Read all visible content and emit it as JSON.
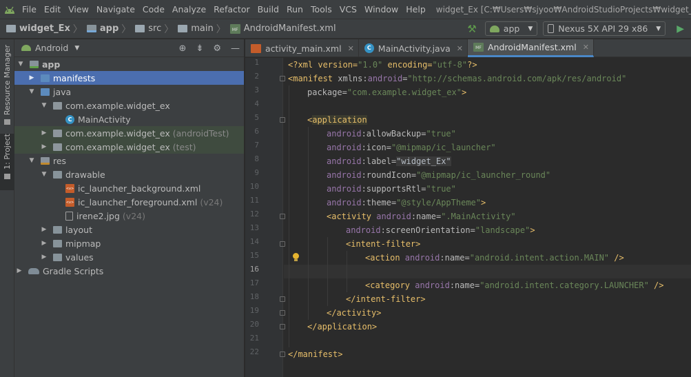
{
  "menubar": {
    "items": [
      "File",
      "Edit",
      "View",
      "Navigate",
      "Code",
      "Analyze",
      "Refactor",
      "Build",
      "Run",
      "Tools",
      "VCS",
      "Window",
      "Help"
    ],
    "window_title": "widget_Ex [C:₩Users₩sjyoo₩AndroidStudioProjects₩widget_Ex] - ...₩app₩sr"
  },
  "navbar": {
    "crumbs": [
      "widget_Ex",
      "app",
      "src",
      "main",
      "AndroidManifest.xml"
    ],
    "run_config": "app",
    "device": "Nexus 5X API 29 x86"
  },
  "strip": {
    "resource_manager": "Resource Manager",
    "project": "1: Project"
  },
  "project": {
    "view_mode": "Android",
    "tree": [
      {
        "label": "app",
        "suffix": ""
      },
      {
        "label": "manifests",
        "suffix": ""
      },
      {
        "label": "java",
        "suffix": ""
      },
      {
        "label": "com.example.widget_ex",
        "suffix": ""
      },
      {
        "label": "MainActivity",
        "suffix": ""
      },
      {
        "label": "com.example.widget_ex",
        "suffix": "(androidTest)"
      },
      {
        "label": "com.example.widget_ex",
        "suffix": "(test)"
      },
      {
        "label": "res",
        "suffix": ""
      },
      {
        "label": "drawable",
        "suffix": ""
      },
      {
        "label": "ic_launcher_background.xml",
        "suffix": ""
      },
      {
        "label": "ic_launcher_foreground.xml",
        "suffix": "(v24)"
      },
      {
        "label": "irene2.jpg",
        "suffix": "(v24)"
      },
      {
        "label": "layout",
        "suffix": ""
      },
      {
        "label": "mipmap",
        "suffix": ""
      },
      {
        "label": "values",
        "suffix": ""
      },
      {
        "label": "Gradle Scripts",
        "suffix": ""
      }
    ]
  },
  "editor": {
    "tabs": [
      {
        "label": "activity_main.xml"
      },
      {
        "label": "MainActivity.java"
      },
      {
        "label": "AndroidManifest.xml"
      }
    ],
    "line_numbers": [
      "1",
      "2",
      "3",
      "4",
      "5",
      "6",
      "7",
      "8",
      "9",
      "10",
      "11",
      "12",
      "13",
      "14",
      "15",
      "16",
      "17",
      "18",
      "19",
      "20",
      "21",
      "22"
    ],
    "code": {
      "l1_a": "<?xml version=",
      "l1_b": "\"1.0\"",
      "l1_c": " encoding=",
      "l1_d": "\"utf-8\"",
      "l1_e": "?>",
      "l2_a": "<manifest ",
      "l2_b": "xmlns:",
      "l2_c": "android",
      "l2_d": "=",
      "l2_e": "\"http://schemas.android.com/apk/res/android\"",
      "l3_a": "package",
      "l3_b": "=",
      "l3_c": "\"com.example.widget_ex\"",
      "l3_d": ">",
      "l5_a": "<",
      "l5_b": "application",
      "ns": "android",
      "a_allowBackup": ":allowBackup",
      "v_allowBackup": "\"true\"",
      "a_icon": ":icon",
      "v_icon": "\"@mipmap/ic_launcher\"",
      "a_label": ":label",
      "v_label": "\"widget_Ex\"",
      "a_roundIcon": ":roundIcon",
      "v_roundIcon": "\"@mipmap/ic_launcher_round\"",
      "a_supportsRtl": ":supportsRtl",
      "v_supportsRtl": "\"true\"",
      "a_theme": ":theme",
      "v_theme": "\"@style/AppTheme\"",
      "l12_a": "<activity ",
      "a_name": ":name",
      "v_activity": "\".MainActivity\"",
      "a_screenOrientation": ":screenOrientation",
      "v_screenOrientation": "\"landscape\"",
      "l14": "<intent-filter>",
      "l15_a": "<action ",
      "v_action": "\"android.intent.action.MAIN\"",
      "l15_e": " />",
      "l17_a": "<category ",
      "v_category": "\"android.intent.category.LAUNCHER\"",
      "l17_e": " />",
      "l18": "</intent-filter>",
      "l19": "</activity>",
      "l20": "</application>",
      "l22": "</manifest>",
      "eq": "=",
      "gt": ">"
    }
  }
}
